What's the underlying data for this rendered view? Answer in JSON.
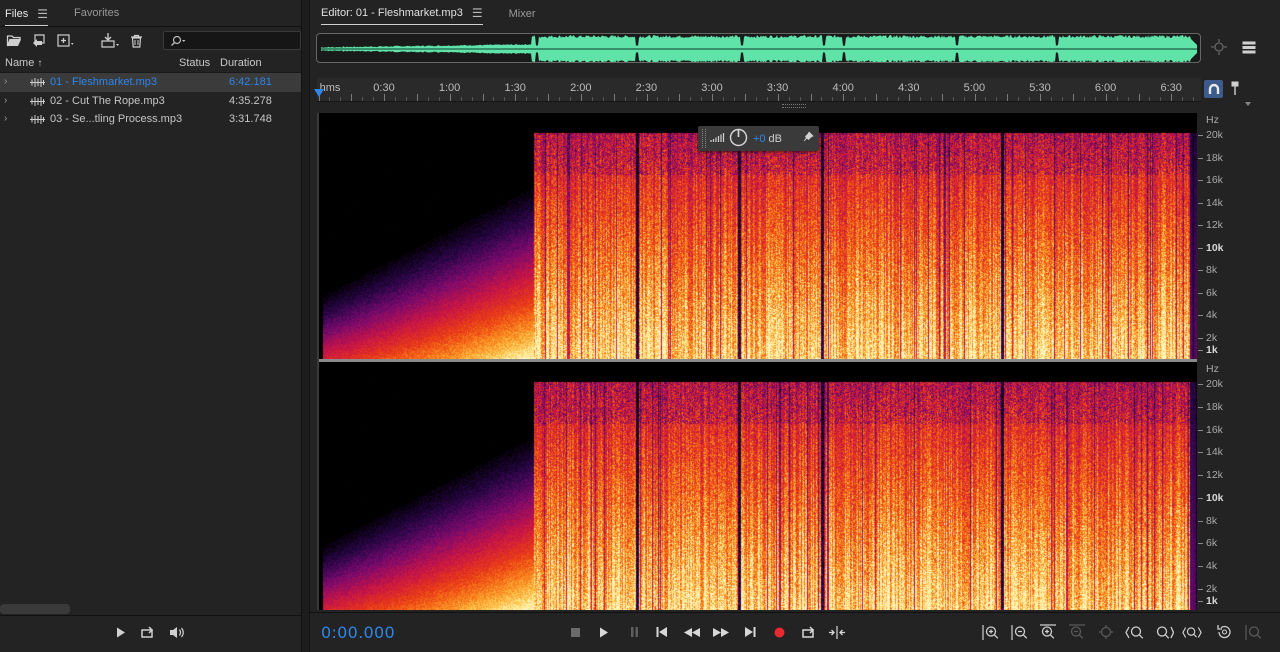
{
  "files_panel": {
    "tabs": [
      {
        "label": "Files"
      },
      {
        "label": "Favorites"
      }
    ],
    "columns": {
      "name": "Name",
      "status": "Status",
      "duration": "Duration"
    },
    "files": [
      {
        "name": "01 - Fleshmarket.mp3",
        "duration": "6:42.181",
        "selected": true
      },
      {
        "name": "02 - Cut The Rope.mp3",
        "duration": "4:35.278",
        "selected": false
      },
      {
        "name": "03 - Se...tling Process.mp3",
        "duration": "3:31.748",
        "selected": false
      }
    ]
  },
  "editor": {
    "tabs": [
      {
        "label": "Editor: 01 - Fleshmarket.mp3"
      },
      {
        "label": "Mixer"
      }
    ],
    "ruler": {
      "unit_label": "hms",
      "labels": [
        "0:30",
        "1:00",
        "1:30",
        "2:00",
        "2:30",
        "3:00",
        "3:30",
        "4:00",
        "4:30",
        "5:00",
        "5:30",
        "6:00",
        "6:30"
      ]
    },
    "freq_axis": {
      "unit": "Hz",
      "labels": [
        "20k",
        "18k",
        "16k",
        "14k",
        "12k",
        "10k",
        "8k",
        "6k",
        "4k",
        "2k",
        "1k"
      ]
    },
    "volume_hud": {
      "value": "+0",
      "unit": "dB"
    },
    "timecode": "0:00.000",
    "colors": {
      "accent": "#2e86e8",
      "waveform": "#5fe3a8"
    }
  }
}
